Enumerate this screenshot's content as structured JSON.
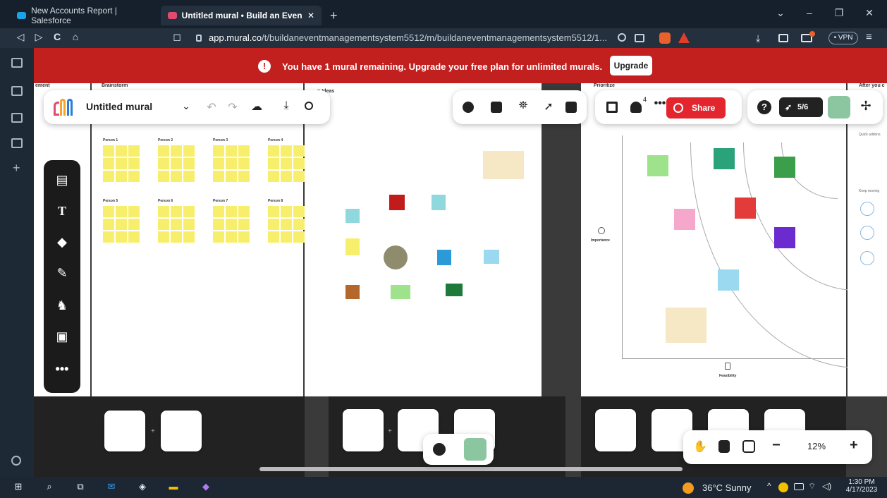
{
  "tabs": [
    {
      "label": "New Accounts Report | Salesforce",
      "favicon_color": "#1aa3e8",
      "active": false
    },
    {
      "label": "Untitled mural • Build an Event M",
      "favicon_color": "#e34a6f",
      "active": true
    }
  ],
  "tab_close": "✕",
  "new_tab": "+",
  "window_controls": {
    "dropdown": "⌄",
    "minimize": "–",
    "restore": "❐",
    "close": "✕"
  },
  "nav": {
    "back": "◁",
    "forward": "▷",
    "reload": "C",
    "home": "⌂",
    "bookmark": "◻"
  },
  "url": {
    "host": "app.mural.co",
    "path": "/t/buildaneventmanagementsystem5512/m/buildaneventmanagementsystem5512/1..."
  },
  "vpn_label": "• VPN",
  "banner": {
    "message": "You have 1 mural remaining. Upgrade your free plan for unlimited murals.",
    "button": "Upgrade",
    "color": "#c21f1f"
  },
  "mural": {
    "title": "Untitled mural",
    "share_label": "Share",
    "collab_count": "4",
    "pill_label": "5/6",
    "zoom_level": "12%",
    "zoom_minus": "−",
    "zoom_plus": "+"
  },
  "canvas": {
    "section_titles": {
      "left_edge": "ement",
      "brainstorm": "Brainstorm",
      "group": "p Ideas",
      "prioritize": "Prioritize",
      "after": "After you c"
    },
    "persons": [
      "Person 1",
      "Person 2",
      "Person 3",
      "Person 4",
      "Person 5",
      "Person 6",
      "Person 7",
      "Person 8"
    ],
    "axes": {
      "y": "Importance",
      "x": "Feasibility"
    },
    "right_labels": [
      "Quick addons",
      "Keep moving"
    ]
  },
  "taskbar": {
    "weather": "36°C  Sunny",
    "time": "1:30 PM",
    "date": "4/17/2023"
  }
}
